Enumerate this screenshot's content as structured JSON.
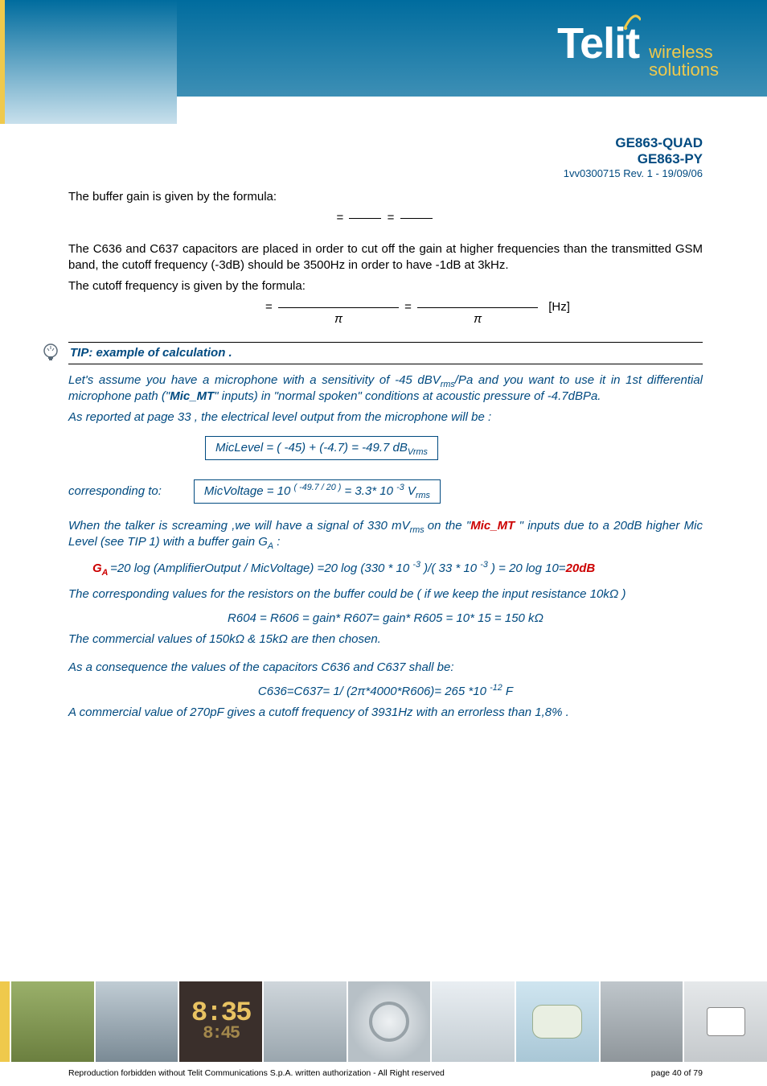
{
  "logo": {
    "mark": "Telit",
    "sub1": "wireless",
    "sub2": "solutions"
  },
  "doc_header": {
    "model1": "GE863-QUAD",
    "model2": "GE863-PY",
    "rev": "1vv0300715 Rev. 1 - 19/09/06"
  },
  "body": {
    "p1": "The buffer gain is given by the formula:",
    "formula1_left": "=",
    "formula1_right": "=",
    "p2": "The C636 and C637 capacitors are placed in order to cut off the gain at higher frequencies than the transmitted GSM band, the cutoff frequency (-3dB) should be 3500Hz in order to have -1dB at 3kHz.",
    "p3": "The cutoff frequency is given by the formula:",
    "formula2_unit": "[Hz]",
    "tip_label": "TIP:  example of calculation  .",
    "tip_p1a": "Let's assume you have a microphone with a sensitivity of  -45 dBV",
    "tip_p1b": "/Pa and you want to use it in 1st differential microphone path (\"",
    "tip_p1_mic": "Mic_MT",
    "tip_p1c": "\" inputs)  in  \"normal spoken\" conditions at  acoustic pressure of -4.7dBPa.",
    "tip_p2": "As reported at page 33 , the electrical level  output from the microphone will be :",
    "box1": "MicLevel  = ( -45) + (-4.7) = -49.7 dB",
    "box1_sub": "Vrms",
    "corresp": "corresponding  to:",
    "box2a": "MicVoltage = 10 ",
    "box2_exp": "( -49.7 / 20 )",
    "box2b": " = 3.3* 10 ",
    "box2_exp2": "-3",
    "box2c": " V",
    "box2_sub": "rms",
    "tip_p3a": " When the talker is screaming ,we will have a signal of 330 mV",
    "tip_p3b": " on the  \"",
    "tip_p3_mic": "Mic_MT",
    "tip_p3c": " \"  inputs due to a 20dB higher Mic Level (see TIP 1) with a buffer gain G",
    "tip_p3d": " :",
    "ga_label": "G",
    "ga_sub": "A ",
    "ga_eq": "=20 log (AmplifierOutput / MicVoltage)  =20 log (330 * 10 ",
    "ga_exp1": "-3",
    "ga_mid": " )/( 33 * 10 ",
    "ga_exp2": "-3",
    "ga_end": " ) = 20 log 10=",
    "ga_result": "20dB",
    "tip_p4": "The corresponding values for the resistors on the buffer could be ( if we keep the input resistance 10kΩ )",
    "r_eq": "R604 = R606 = gain* R607= gain* R605 = 10* 15 = 150 kΩ",
    "tip_p5": "The commercial values of 150kΩ & 15kΩ are then chosen.",
    "tip_p6": "As a consequence the values of the capacitors C636 and C637 shall be:",
    "c_eq_a": "C636=C637= 1/ (2π*4000*R606)= 265 *10 ",
    "c_eq_exp": "-12",
    "c_eq_b": " F",
    "tip_p7": "A commercial value of 270pF gives  a cutoff frequency  of  3931Hz with an errorless than 1,8%  ."
  },
  "footer": {
    "clock": "8:35",
    "clock2": "8:45",
    "copy": "Reproduction forbidden without Telit Communications S.p.A. written authorization - All Right reserved",
    "page": "page 40 of 79"
  }
}
